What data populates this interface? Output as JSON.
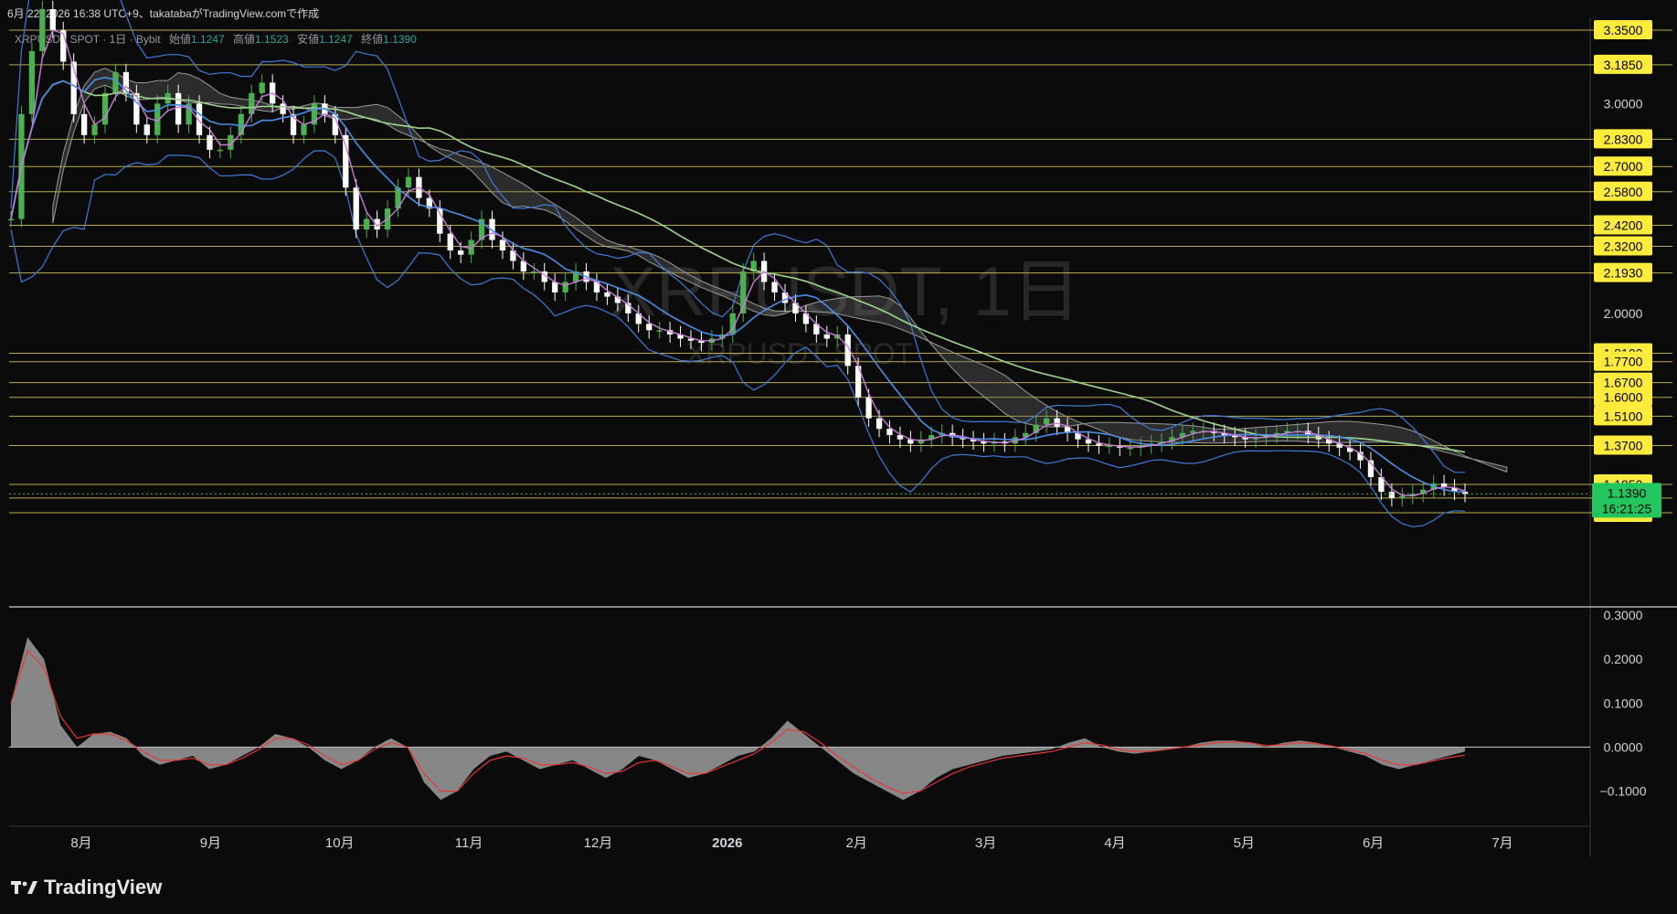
{
  "header": {
    "text": "6月 22, 2026 16:38 UTC+9、takatabaがTradingView.comで作成"
  },
  "legend": {
    "symbol": "XRPUSDT SPOT · 1日 · Bybit",
    "open_label": "始値",
    "open": "1.1247",
    "high_label": "高値",
    "high": "1.1523",
    "low_label": "安値",
    "low": "1.1247",
    "close_label": "終値",
    "close": "1.1390"
  },
  "watermark": {
    "title": "XRPUSDT, 1日",
    "subtitle": "XRPUSDT SPOT"
  },
  "price_badge": {
    "price": "1.1390",
    "countdown": "16:21:25"
  },
  "footer": {
    "brand": "TradingView"
  },
  "colors": {
    "background": "#0b0b0b",
    "hline": "#d9c85a",
    "up": "#4caf50",
    "down": "#ffffff",
    "ma_fast": "#c97ddb",
    "ma_mid": "#4c8fe6",
    "ma_slow": "#9ed68c",
    "bollinger": "#3f7bd8",
    "cloud": "#6b6b6b",
    "label_bg": "#ffeb3b"
  },
  "chart_data": [
    {
      "type": "line",
      "title": "XRPUSDT, 1日",
      "y_axis_ticks": [
        "3.0000",
        "2.0000"
      ],
      "horizontal_levels": [
        "3.3500",
        "3.1850",
        "2.8300",
        "2.7000",
        "2.5800",
        "2.4200",
        "2.3200",
        "2.1930",
        "1.8100",
        "1.7700",
        "1.6700",
        "1.6000",
        "1.5100",
        "1.3700",
        "1.1850",
        "1.1200",
        "1.0500"
      ],
      "x_axis_labels": [
        "8月",
        "9月",
        "10月",
        "11月",
        "12月",
        "2026",
        "2月",
        "3月",
        "4月",
        "5月",
        "6月",
        "7月"
      ],
      "series": [
        {
          "values": [
            2.45,
            2.95,
            3.25,
            3.45,
            3.35,
            3.2,
            2.95,
            2.85,
            2.9,
            3.05,
            3.15,
            3.05,
            2.9,
            2.85,
            3.0,
            3.05,
            2.9,
            3.0,
            2.85,
            2.78,
            2.78,
            2.85,
            2.95,
            3.05,
            3.1,
            3.0,
            2.95,
            2.85,
            2.9,
            3.0,
            2.95,
            2.85,
            2.6,
            2.4,
            2.45,
            2.4,
            2.5,
            2.6,
            2.65,
            2.55,
            2.5,
            2.38,
            2.3,
            2.28,
            2.35,
            2.45,
            2.35,
            2.3,
            2.25,
            2.2,
            2.2,
            2.15,
            2.1,
            2.15,
            2.2,
            2.15,
            2.1,
            2.08,
            2.05,
            2.0,
            1.95,
            1.92,
            1.92,
            1.9,
            1.88,
            1.87,
            1.86,
            1.88,
            1.9,
            2.0,
            2.2,
            2.25,
            2.15,
            2.1,
            2.05,
            2.0,
            1.95,
            1.9,
            1.88,
            1.9,
            1.75,
            1.6,
            1.5,
            1.45,
            1.42,
            1.4,
            1.38,
            1.4,
            1.42,
            1.43,
            1.41,
            1.4,
            1.39,
            1.38,
            1.39,
            1.38,
            1.41,
            1.43,
            1.47,
            1.5,
            1.46,
            1.43,
            1.4,
            1.38,
            1.37,
            1.37,
            1.36,
            1.36,
            1.37,
            1.38,
            1.39,
            1.41,
            1.43,
            1.44,
            1.44,
            1.43,
            1.42,
            1.41,
            1.4,
            1.41,
            1.42,
            1.43,
            1.44,
            1.44,
            1.42,
            1.4,
            1.38,
            1.36,
            1.34,
            1.3,
            1.22,
            1.15,
            1.12,
            1.13,
            1.14,
            1.16,
            1.19,
            1.17,
            1.15,
            1.14
          ]
        },
        {
          "name": "",
          "values": []
        }
      ]
    },
    {
      "type": "area",
      "y_axis_ticks": [
        "0.3000",
        "0.2000",
        "0.1000",
        "0.0000",
        "−0.1000"
      ],
      "ylim": [
        -0.13,
        0.3
      ],
      "series": [
        {
          "values": [
            0.1,
            0.25,
            0.2,
            0.05,
            0.0,
            0.03,
            0.035,
            0.02,
            -0.02,
            -0.04,
            -0.03,
            -0.02,
            -0.05,
            -0.04,
            -0.02,
            0.0,
            0.03,
            0.02,
            0.0,
            -0.03,
            -0.05,
            -0.03,
            0.0,
            0.02,
            0.0,
            -0.08,
            -0.12,
            -0.1,
            -0.05,
            -0.02,
            -0.01,
            -0.03,
            -0.05,
            -0.04,
            -0.03,
            -0.05,
            -0.07,
            -0.05,
            -0.02,
            -0.03,
            -0.05,
            -0.07,
            -0.06,
            -0.04,
            -0.02,
            -0.01,
            0.02,
            0.06,
            0.03,
            0.0,
            -0.03,
            -0.06,
            -0.08,
            -0.1,
            -0.12,
            -0.1,
            -0.07,
            -0.05,
            -0.04,
            -0.03,
            -0.02,
            -0.015,
            -0.01,
            -0.005,
            0.01,
            0.02,
            0.0,
            -0.01,
            -0.015,
            -0.01,
            -0.005,
            0.0,
            0.01,
            0.015,
            0.015,
            0.01,
            0.0,
            0.01,
            0.015,
            0.01,
            0.0,
            -0.01,
            -0.02,
            -0.04,
            -0.05,
            -0.04,
            -0.03,
            -0.02,
            -0.01
          ]
        },
        {
          "values": [
            0.1,
            0.22,
            0.18,
            0.07,
            0.02,
            0.03,
            0.03,
            0.015,
            -0.01,
            -0.03,
            -0.03,
            -0.025,
            -0.04,
            -0.04,
            -0.025,
            -0.005,
            0.02,
            0.02,
            0.005,
            -0.02,
            -0.04,
            -0.03,
            -0.005,
            0.01,
            0.0,
            -0.06,
            -0.1,
            -0.1,
            -0.06,
            -0.03,
            -0.02,
            -0.025,
            -0.04,
            -0.04,
            -0.035,
            -0.045,
            -0.06,
            -0.055,
            -0.035,
            -0.03,
            -0.045,
            -0.06,
            -0.06,
            -0.045,
            -0.03,
            -0.015,
            0.01,
            0.04,
            0.035,
            0.01,
            -0.02,
            -0.045,
            -0.07,
            -0.09,
            -0.105,
            -0.1,
            -0.08,
            -0.06,
            -0.045,
            -0.035,
            -0.025,
            -0.02,
            -0.015,
            -0.01,
            0.0,
            0.01,
            0.005,
            -0.005,
            -0.01,
            -0.01,
            -0.005,
            0.0,
            0.005,
            0.01,
            0.012,
            0.01,
            0.003,
            0.006,
            0.01,
            0.008,
            0.002,
            -0.006,
            -0.015,
            -0.03,
            -0.04,
            -0.04,
            -0.032,
            -0.024,
            -0.018
          ]
        }
      ]
    }
  ]
}
